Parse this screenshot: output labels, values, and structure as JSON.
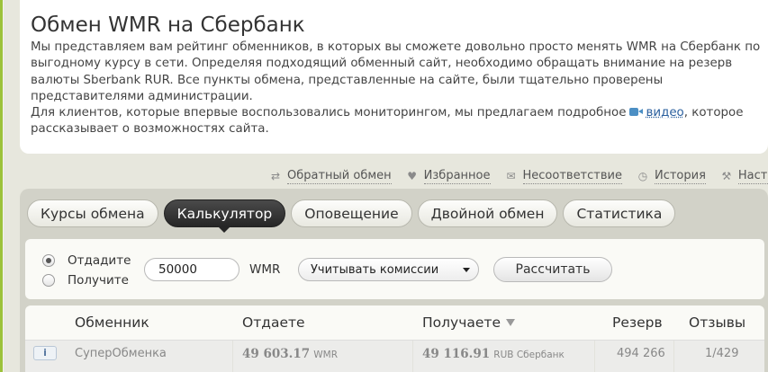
{
  "page": {
    "title": "Обмен WMR на Сбербанк",
    "intro_lines": [
      "Мы представляем вам рейтинг обменников, в которых вы сможете довольно просто менять WMR на Сбербанк по",
      "выгодному курсу в сети. Определяя подходящий обменный сайт, необходимо обращать внимание на резерв",
      "валюты Sberbank RUR. Все пункты обмена, представленные на сайте, были тщательно проверены",
      "представителями администрации."
    ],
    "intro_video_before": "Для клиентов, которые впервые воспользовались мониторингом, мы предлагаем подробное",
    "intro_video_link": "видео",
    "intro_video_after": ", которое",
    "intro_last_line": "рассказывает о возможностях сайта."
  },
  "actions": [
    {
      "label": "Обратный обмен",
      "icon": "swap-arrows-icon"
    },
    {
      "label": "Избранное",
      "icon": "heart-icon"
    },
    {
      "label": "Несоответствие",
      "icon": "mail-icon"
    },
    {
      "label": "История",
      "icon": "clock-icon"
    },
    {
      "label": "Настройка",
      "icon": "wrench-icon"
    }
  ],
  "tabs": [
    {
      "label": "Курсы обмена",
      "active": false
    },
    {
      "label": "Калькулятор",
      "active": true
    },
    {
      "label": "Оповещение",
      "active": false
    },
    {
      "label": "Двойной обмен",
      "active": false
    },
    {
      "label": "Статистика",
      "active": false
    }
  ],
  "calculator": {
    "radio_give": "Отдадите",
    "radio_get": "Получите",
    "selected": "give",
    "amount": "50000",
    "currency": "WMR",
    "commission_select": "Учитывать комиссии",
    "submit": "Рассчитать"
  },
  "table": {
    "headers": {
      "exchanger": "Обменник",
      "give": "Отдаете",
      "get": "Получаете",
      "reserve": "Резерв",
      "reviews": "Отзывы"
    },
    "rows": [
      {
        "info": "i",
        "exchanger": "СуперОбменка",
        "give_amount": "49 603.17",
        "give_currency": "WMR",
        "get_amount": "49 116.91",
        "get_currency": "RUB Сбербанк",
        "reserve": "494 266",
        "reviews": "1/429"
      }
    ]
  },
  "colors": {
    "accent_green": "#9cc23a",
    "link_blue": "#2a5f9e",
    "active_tab": "#262626"
  }
}
